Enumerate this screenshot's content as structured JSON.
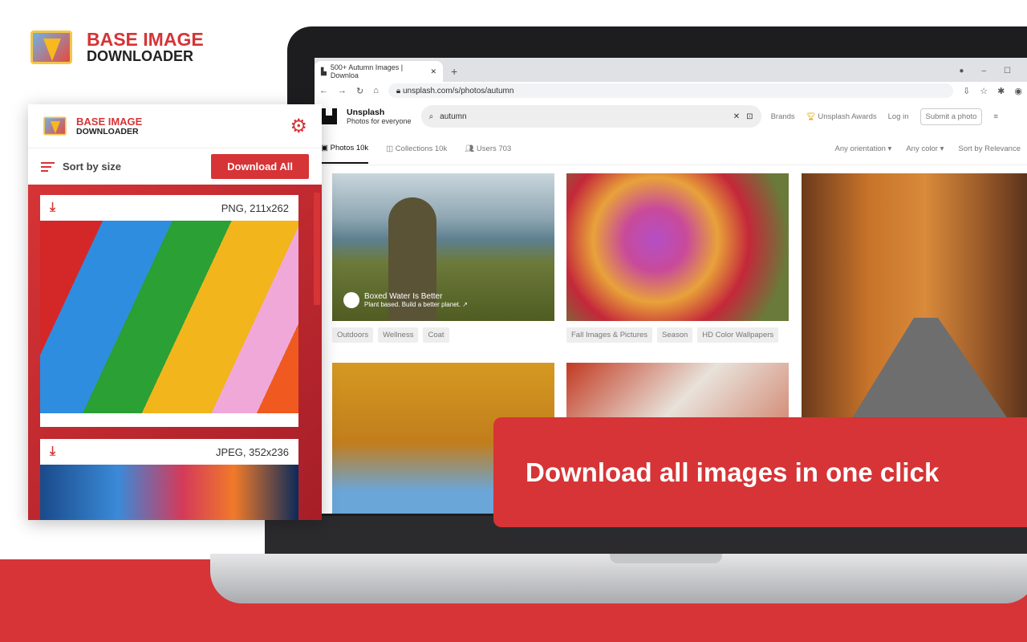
{
  "brand": {
    "line1": "BASE IMAGE",
    "line2": "DOWNLOADER"
  },
  "browser": {
    "tab_title": "500+ Autumn Images | Downloa",
    "url": "unsplash.com/s/photos/autumn"
  },
  "unsplash": {
    "name": "Unsplash",
    "tagline": "Photos for everyone",
    "search_value": "autumn",
    "nav": [
      "Brands",
      "Unsplash Awards",
      "Log in",
      "Submit a photo"
    ],
    "tabs": [
      "Photos 10k",
      "Collections 10k",
      "Users 703"
    ],
    "filters": [
      "Any orientation",
      "Any color",
      "Sort by Relevance"
    ],
    "sponsor": {
      "name": "Boxed Water Is Better",
      "tagline": "Plant based. Build a better planet. ↗"
    },
    "tags1": [
      "Outdoors",
      "Wellness",
      "Coat"
    ],
    "tags2": [
      "Fall Images & Pictures",
      "Season",
      "HD Color Wallpapers"
    ]
  },
  "popup": {
    "sort_label": "Sort by size",
    "download_all": "Download All",
    "images": [
      {
        "meta": "PNG, 211x262"
      },
      {
        "meta": "JPEG, 352x236"
      }
    ]
  },
  "banner": "Download all images in one click",
  "colors": {
    "accent": "#d63436"
  }
}
